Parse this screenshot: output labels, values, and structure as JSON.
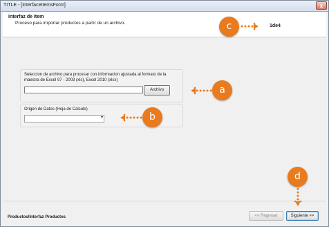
{
  "window": {
    "title": "TITLE - [InterfaceItemsForm]",
    "close_glyph": "x"
  },
  "header": {
    "title": "Interfaz de Item",
    "subtitle": "Proceso para importar productos a partir de un archivo.",
    "code": "1de4"
  },
  "file_group": {
    "label": "Seleccion de archivo para procesar con informacion ajustada al formato de la maestra de Excel 97 - 2003 (xls), Excel 2010 (xlsx)",
    "input_value": "",
    "button_label": "Archivo"
  },
  "source_group": {
    "label": "Origen de Datos (Hoja de Calculo)",
    "selected_value": ""
  },
  "footer": {
    "label": "Productos/Interfaz Productos",
    "prev_label": "<< Regresar",
    "next_label": "Siguiente >>"
  },
  "annotations": {
    "a": "a",
    "b": "b",
    "c": "c",
    "d": "d",
    "color": "#e97a1e"
  }
}
